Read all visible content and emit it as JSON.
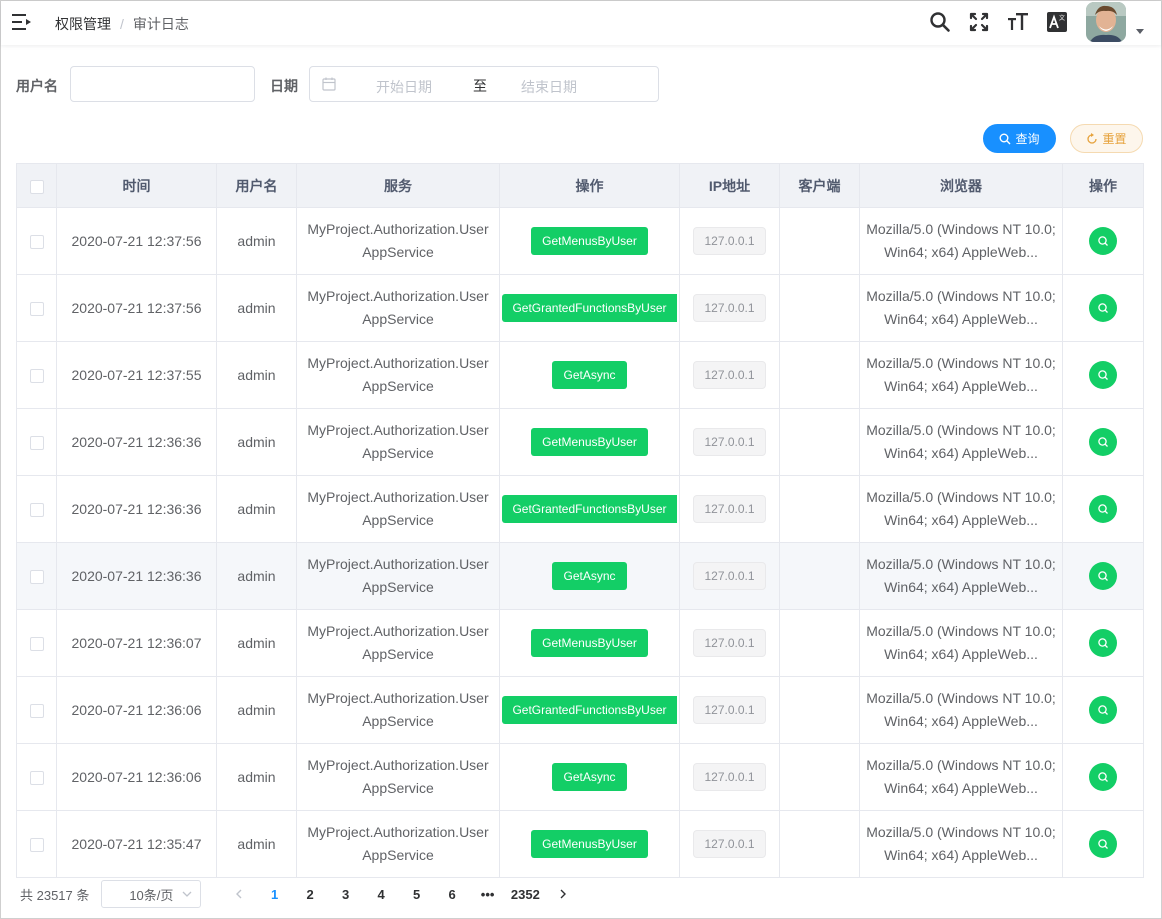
{
  "header": {
    "breadcrumb": [
      "权限管理",
      "审计日志"
    ],
    "bc_separator": "/"
  },
  "search": {
    "username_label": "用户名",
    "username_value": "",
    "date_label": "日期",
    "start_placeholder": "开始日期",
    "range_separator": "至",
    "end_placeholder": "结束日期",
    "query_label": "查询",
    "reset_label": "重置"
  },
  "table": {
    "columns": [
      "时间",
      "用户名",
      "服务",
      "操作",
      "IP地址",
      "客户端",
      "浏览器",
      "操作"
    ],
    "rows": [
      {
        "time": "2020-07-21 12:37:56",
        "user": "admin",
        "service": "MyProject.Authorization.UserAppService",
        "op": "GetMenusByUser",
        "ip": "127.0.0.1",
        "client": "",
        "browser": "Mozilla/5.0 (Windows NT 10.0; Win64; x64) AppleWeb..."
      },
      {
        "time": "2020-07-21 12:37:56",
        "user": "admin",
        "service": "MyProject.Authorization.UserAppService",
        "op": "GetGrantedFunctionsByUser",
        "ip": "127.0.0.1",
        "client": "",
        "browser": "Mozilla/5.0 (Windows NT 10.0; Win64; x64) AppleWeb..."
      },
      {
        "time": "2020-07-21 12:37:55",
        "user": "admin",
        "service": "MyProject.Authorization.UserAppService",
        "op": "GetAsync",
        "ip": "127.0.0.1",
        "client": "",
        "browser": "Mozilla/5.0 (Windows NT 10.0; Win64; x64) AppleWeb..."
      },
      {
        "time": "2020-07-21 12:36:36",
        "user": "admin",
        "service": "MyProject.Authorization.UserAppService",
        "op": "GetMenusByUser",
        "ip": "127.0.0.1",
        "client": "",
        "browser": "Mozilla/5.0 (Windows NT 10.0; Win64; x64) AppleWeb..."
      },
      {
        "time": "2020-07-21 12:36:36",
        "user": "admin",
        "service": "MyProject.Authorization.UserAppService",
        "op": "GetGrantedFunctionsByUser",
        "ip": "127.0.0.1",
        "client": "",
        "browser": "Mozilla/5.0 (Windows NT 10.0; Win64; x64) AppleWeb..."
      },
      {
        "time": "2020-07-21 12:36:36",
        "user": "admin",
        "service": "MyProject.Authorization.UserAppService",
        "op": "GetAsync",
        "ip": "127.0.0.1",
        "client": "",
        "browser": "Mozilla/5.0 (Windows NT 10.0; Win64; x64) AppleWeb..."
      },
      {
        "time": "2020-07-21 12:36:07",
        "user": "admin",
        "service": "MyProject.Authorization.UserAppService",
        "op": "GetMenusByUser",
        "ip": "127.0.0.1",
        "client": "",
        "browser": "Mozilla/5.0 (Windows NT 10.0; Win64; x64) AppleWeb..."
      },
      {
        "time": "2020-07-21 12:36:06",
        "user": "admin",
        "service": "MyProject.Authorization.UserAppService",
        "op": "GetGrantedFunctionsByUser",
        "ip": "127.0.0.1",
        "client": "",
        "browser": "Mozilla/5.0 (Windows NT 10.0; Win64; x64) AppleWeb..."
      },
      {
        "time": "2020-07-21 12:36:06",
        "user": "admin",
        "service": "MyProject.Authorization.UserAppService",
        "op": "GetAsync",
        "ip": "127.0.0.1",
        "client": "",
        "browser": "Mozilla/5.0 (Windows NT 10.0; Win64; x64) AppleWeb..."
      },
      {
        "time": "2020-07-21 12:35:47",
        "user": "admin",
        "service": "MyProject.Authorization.UserAppService",
        "op": "GetMenusByUser",
        "ip": "127.0.0.1",
        "client": "",
        "browser": "Mozilla/5.0 (Windows NT 10.0; Win64; x64) AppleWeb..."
      }
    ],
    "highlighted_row": 5
  },
  "pagination": {
    "total_text": "共 23517 条",
    "page_size": "10条/页",
    "pages": [
      "1",
      "2",
      "3",
      "4",
      "5",
      "6"
    ],
    "ellipsis": "•••",
    "last_page": "2352",
    "current_page": "1"
  },
  "colors": {
    "primary": "#1890ff",
    "success": "#13ce66",
    "warning": "#e6a23c"
  },
  "icons": {
    "hamburger": "hamburger-icon",
    "search": "search-icon",
    "fullscreen": "fullscreen-icon",
    "font_size": "font-size-icon",
    "language": "translate-icon",
    "calendar": "calendar-icon",
    "view": "search-icon"
  }
}
